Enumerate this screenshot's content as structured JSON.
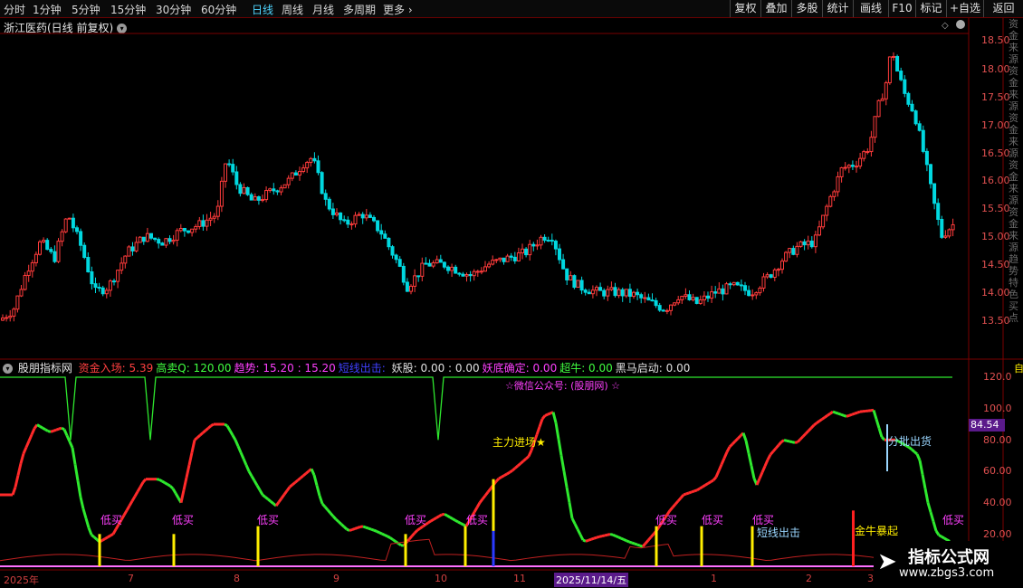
{
  "toolbar": {
    "left": [
      {
        "label": "分时",
        "active": false
      },
      {
        "label": "1分钟",
        "active": false
      },
      {
        "label": "5分钟",
        "active": false
      },
      {
        "label": "15分钟",
        "active": false
      },
      {
        "label": "30分钟",
        "active": false
      },
      {
        "label": "60分钟",
        "active": false
      },
      {
        "label": "日线",
        "active": true
      },
      {
        "label": "周线",
        "active": false
      },
      {
        "label": "月线",
        "active": false
      },
      {
        "label": "多周期",
        "active": false
      },
      {
        "label": "更多",
        "active": false
      }
    ],
    "right": [
      "复权",
      "叠加",
      "多股",
      "统计",
      "画线",
      "F10",
      "标记",
      "+自选",
      "返回"
    ]
  },
  "stock_title": "浙江医药(日线 前复权)",
  "price_axis": [
    "18.50",
    "18.00",
    "17.50",
    "17.00",
    "16.50",
    "16.00",
    "15.50",
    "15.00",
    "14.50",
    "14.00",
    "13.50"
  ],
  "indicator": {
    "name": "股朋指标网",
    "items": [
      {
        "text": "资金入场: 5.39",
        "color": "#ff4040"
      },
      {
        "text": "高卖Q: 120.00",
        "color": "#40ff40"
      },
      {
        "text": "趋势: 15.20 : 15.20",
        "color": "#ff40ff"
      },
      {
        "text": "短线出击: ",
        "color": "#4040ff"
      },
      {
        "text": "妖股: 0.00 : 0.00",
        "color": "#e0e0e0"
      },
      {
        "text": "妖底确定: 0.00",
        "color": "#ff40ff"
      },
      {
        "text": "超牛: 0.00",
        "color": "#40ff40"
      },
      {
        "text": "黑马启动: 0.00",
        "color": "#e0e0e0"
      }
    ],
    "axis": [
      "120.0",
      "100.0",
      "80.00",
      "60.00",
      "40.00",
      "20.00"
    ],
    "current_value": "84.54",
    "right_edge": "自"
  },
  "annotations": {
    "wechat": "☆微信公众号: (股朋网) ☆",
    "main_force": "主力进场",
    "batch_sell": "分批出货",
    "short_attack": "短线出击",
    "golden_bull": "金牛暴起",
    "low_buy": "低买",
    "low_buy_partial": "低买"
  },
  "dates": [
    "2025年",
    "7",
    "8",
    "9",
    "10",
    "11",
    "2025/11/14/五",
    "1",
    "2",
    "3"
  ],
  "watermark": {
    "title": "指标公式网",
    "url": "www.zbgs3.com"
  },
  "side_text": "资金来源资金来源资金来源资金来源资金来源趋势特色买点",
  "colors": {
    "up": "#ff3b3b",
    "down": "#00d8e0",
    "green": "#2ee82e",
    "gold": "#ffee00",
    "magenta": "#ff40ff",
    "grid": "#7a0000"
  }
}
